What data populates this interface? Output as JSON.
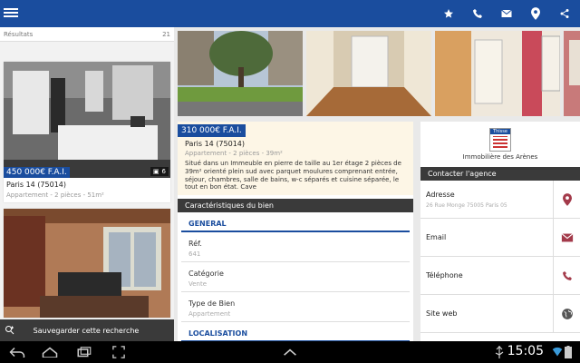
{
  "colors": {
    "brand": "#1a4d9e",
    "dark": "#3a3a3a",
    "accent_icon": "#a33a4a"
  },
  "topbar": {
    "menu_icon": "hamburger-icon",
    "actions": [
      "star-icon",
      "phone-icon",
      "mail-icon",
      "map-pin-icon",
      "share-icon"
    ]
  },
  "results": {
    "label": "Résultats",
    "count": "21"
  },
  "listings": [
    {
      "price": "450 000€ F.A.I.",
      "city": "Paris 14 (75014)",
      "sub": "Appartement - 2 pièces - 51m²",
      "photo_count": "6"
    },
    {
      "price": "",
      "city": "",
      "sub": "",
      "photo_count": ""
    }
  ],
  "save_search": "Sauvegarder cette recherche",
  "detail": {
    "price": "310 000€ F.A.I.",
    "city": "Paris 14 (75014)",
    "sub": "Appartement - 2 pièces - 39m²",
    "description": "Situé dans un Immeuble en pierre de taille au 1er étage 2 pièces de 39m² orienté plein sud avec parquet moulures comprenant entrée, séjour, chambres, salle de bains, w-c séparés et cuisine séparée, le tout en bon état. Cave",
    "section_title": "Caractéristiques du bien",
    "general_label": "GENERAL",
    "rows": [
      {
        "key": "Réf.",
        "value": "641"
      },
      {
        "key": "Catégorie",
        "value": "Vente"
      },
      {
        "key": "Type de Bien",
        "value": "Appartement"
      }
    ],
    "localisation_label": "LOCALISATION"
  },
  "agency": {
    "logo_text": "Thisse",
    "name": "Immobilière des Arènes",
    "contact_title": "Contacter l'agence",
    "lines": [
      {
        "key": "Adresse",
        "value": "26 Rue Monge 75005 Paris 05",
        "icon": "map-pin-icon"
      },
      {
        "key": "Email",
        "value": "",
        "icon": "mail-icon"
      },
      {
        "key": "Téléphone",
        "value": "",
        "icon": "phone-icon"
      },
      {
        "key": "Site web",
        "value": "",
        "icon": "globe-icon"
      }
    ]
  },
  "system": {
    "time": "15:05"
  }
}
